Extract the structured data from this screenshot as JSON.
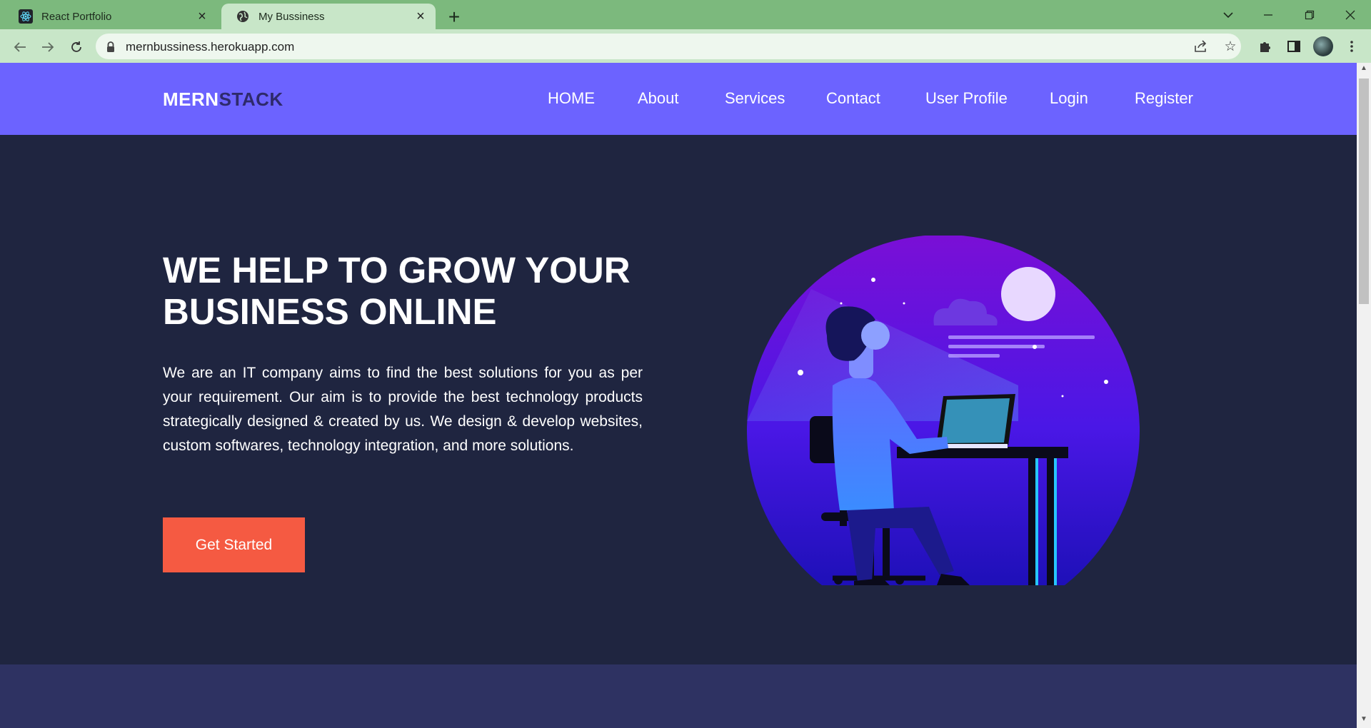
{
  "browser": {
    "tabs": [
      {
        "title": "React Portfolio",
        "icon": "react-icon"
      },
      {
        "title": "My Bussiness",
        "icon": "globe-icon"
      }
    ],
    "url": "mernbussiness.herokuapp.com",
    "colors": {
      "tabbar": "#7cb97d",
      "toolbar": "#c8e6c8"
    }
  },
  "site": {
    "logo_part1": "MERN",
    "logo_part2": "STACK",
    "nav": [
      "HOME",
      "About",
      "Services",
      "Contact",
      "User Profile",
      "Login",
      "Register"
    ],
    "hero": {
      "title_line1": "WE HELP TO GROW YOUR",
      "title_line2": "BUSINESS ONLINE",
      "description": "We are an IT company aims to find the best solutions for you as per your requirement. Our aim is to provide the best technology products strategically designed & created by us. We design & develop websites, custom softwares, technology integration, and more solutions.",
      "cta": "Get Started"
    },
    "colors": {
      "navbar": "#6c63ff",
      "hero_bg": "#1f2540",
      "cta": "#f55a42",
      "section2": "#2e3262"
    }
  }
}
